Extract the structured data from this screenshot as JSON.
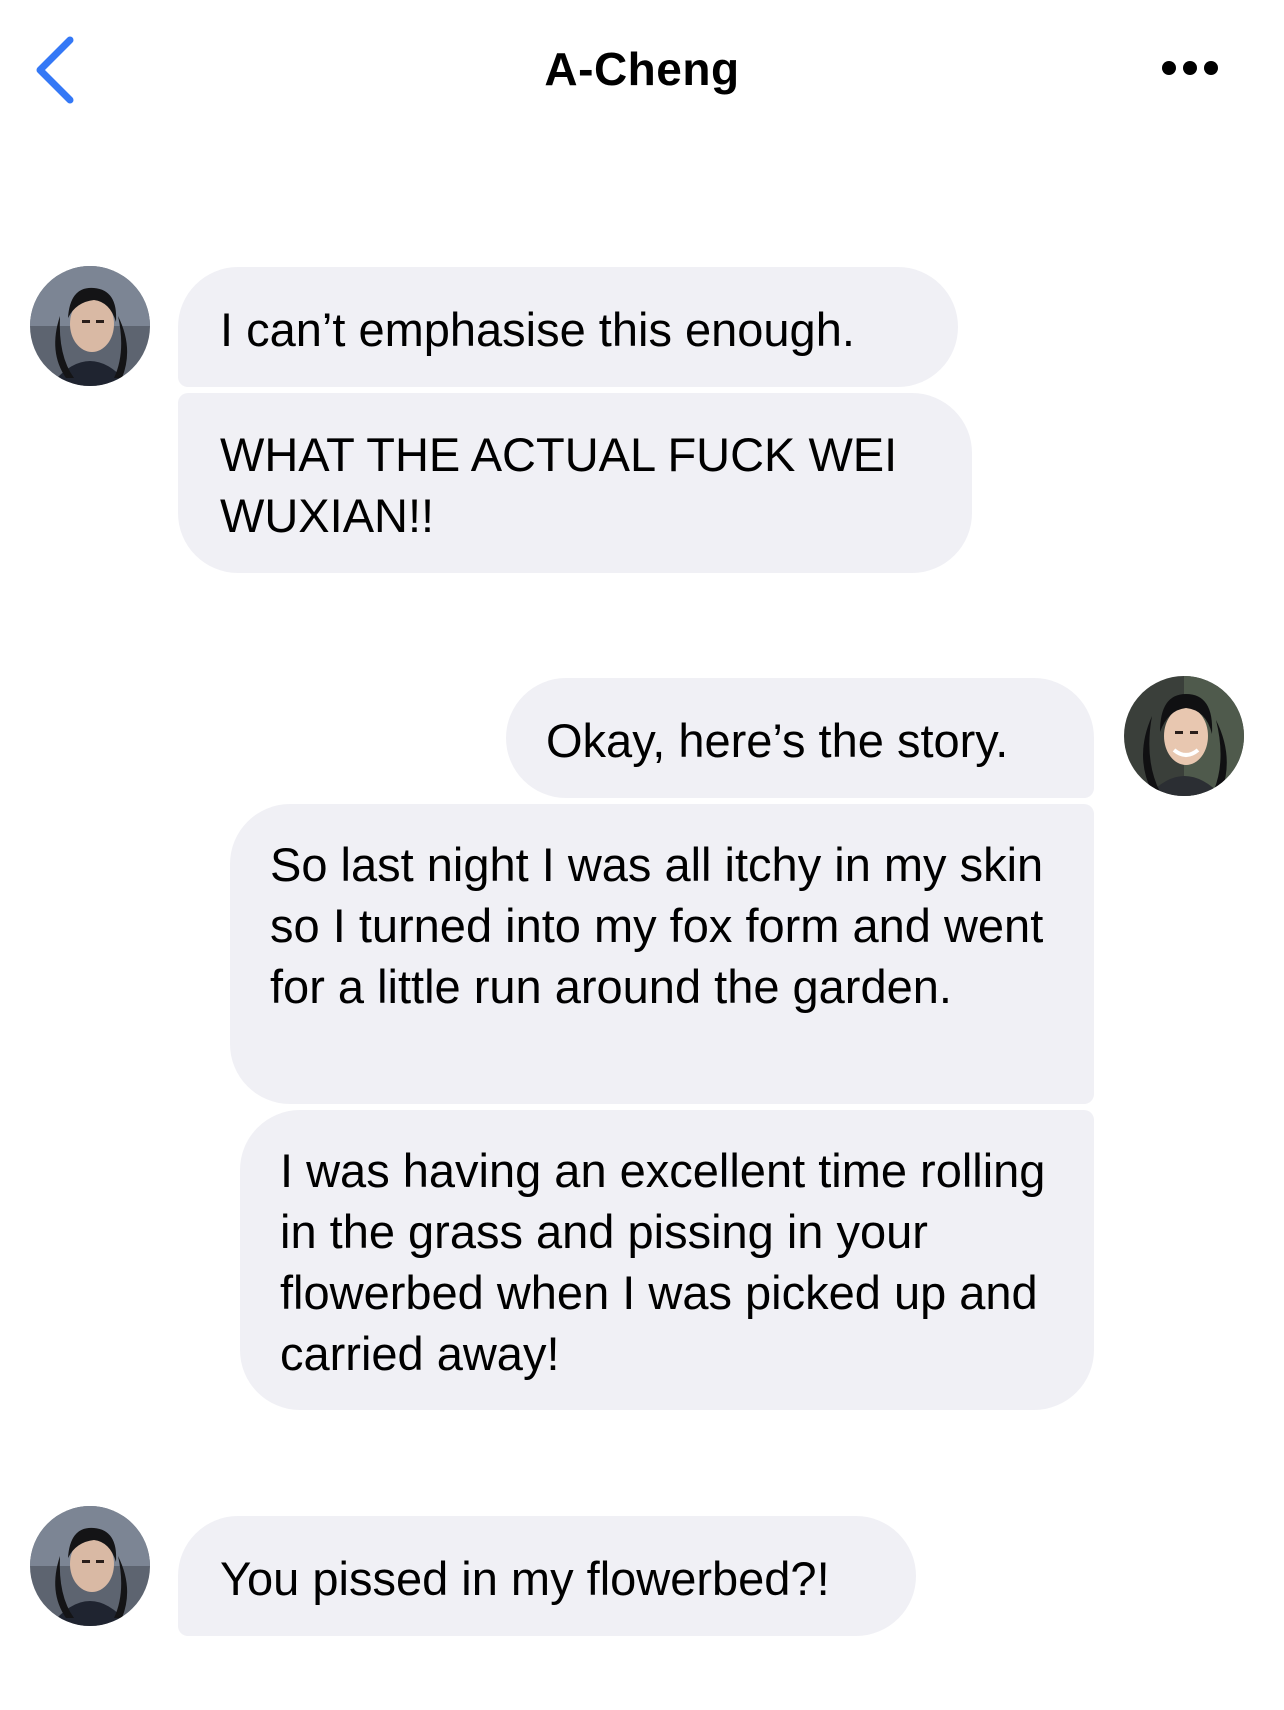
{
  "header": {
    "back_icon": "chevron-left-icon",
    "title": "A-Cheng",
    "more_icon": "ellipsis-icon",
    "accent_color": "#3478f6"
  },
  "messages": [
    {
      "sender": "contact",
      "text": "I can’t emphasise this enough."
    },
    {
      "sender": "contact",
      "text": "WHAT THE ACTUAL FUCK WEI WUXIAN!!"
    },
    {
      "sender": "me",
      "text": "Okay, here’s the story."
    },
    {
      "sender": "me",
      "text": "So last night I was all itchy in my skin so I turned into my fox form and went for a little run around the garden."
    },
    {
      "sender": "me",
      "text": "I was having an excellent time rolling in the grass and pissing in your flowerbed when I was picked up and carried away!"
    },
    {
      "sender": "contact",
      "text": "You pissed in my flowerbed?!"
    }
  ],
  "colors": {
    "bubble_background": "#f0f0f5",
    "page_background": "#ffffff"
  }
}
